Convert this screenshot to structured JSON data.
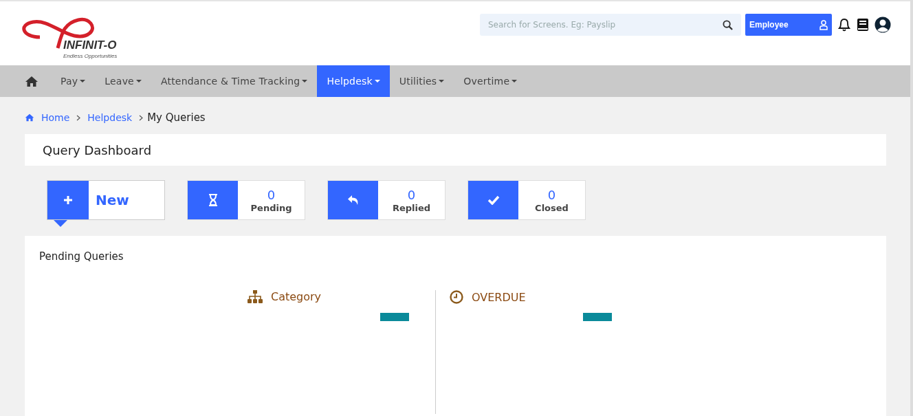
{
  "logo": {
    "name": "INFINIT-O",
    "tagline": "Endless Opportunities"
  },
  "search": {
    "placeholder": "Search for Screens. Eg: Payslip"
  },
  "role_button": {
    "label": "Employee"
  },
  "nav": [
    {
      "label": "Pay",
      "selected": false
    },
    {
      "label": "Leave",
      "selected": false
    },
    {
      "label": "Attendance & Time Tracking",
      "selected": false
    },
    {
      "label": "Helpdesk",
      "selected": true
    },
    {
      "label": "Utilities",
      "selected": false
    },
    {
      "label": "Overtime",
      "selected": false
    }
  ],
  "breadcrumb": {
    "links": [
      "Home",
      "Helpdesk"
    ],
    "current": "My Queries"
  },
  "page_title": "Query Dashboard",
  "tiles": [
    {
      "kind": "new",
      "label": "New",
      "selected": true
    },
    {
      "kind": "pending",
      "count": "0",
      "label": "Pending",
      "selected": false
    },
    {
      "kind": "replied",
      "count": "0",
      "label": "Replied",
      "selected": false
    },
    {
      "kind": "closed",
      "count": "0",
      "label": "Closed",
      "selected": false
    }
  ],
  "panel": {
    "title": "Pending Queries",
    "sections": [
      {
        "kind": "category",
        "title": "Category"
      },
      {
        "kind": "overdue",
        "title": "OVERDUE"
      }
    ]
  }
}
